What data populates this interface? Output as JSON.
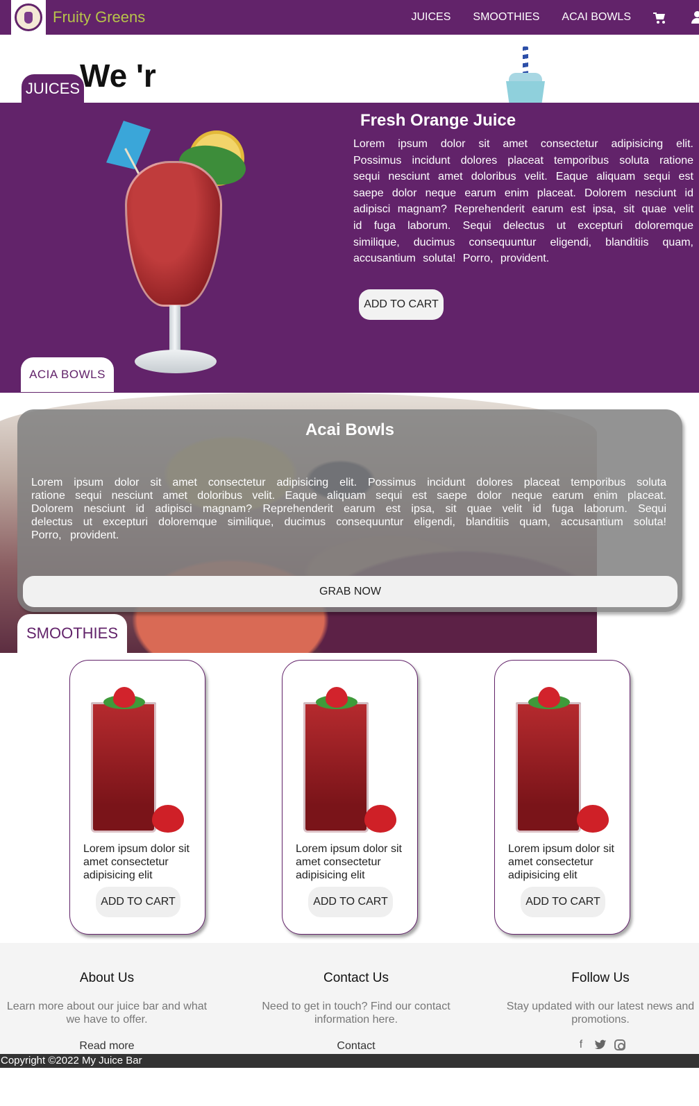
{
  "brand": {
    "name": "Fruity Greens"
  },
  "nav": {
    "links": [
      "JUICES",
      "SMOOTHIES",
      "ACAI BOWLS"
    ],
    "cart_icon": "cart-icon",
    "user_icon": "user-icon"
  },
  "hero": {
    "text": "We 'r"
  },
  "tabs": {
    "juices": "JUICES",
    "acai": "ACIA BOWLS",
    "smoothies": "SMOOTHIES"
  },
  "juice": {
    "title": "Fresh Orange Juice",
    "description": "Lorem ipsum dolor sit amet consectetur adipisicing elit. Possimus incidunt dolores placeat temporibus soluta ratione sequi nesciunt amet doloribus velit. Eaque aliquam sequi est saepe dolor neque earum enim placeat. Dolorem nesciunt id adipisci magnam? Reprehenderit earum est ipsa, sit quae velit id fuga laborum. Sequi delectus ut excepturi doloremque similique, ducimus consequuntur eligendi, blanditiis quam, accusantium soluta! Porro, provident.",
    "button": "ADD TO CART"
  },
  "acai": {
    "title": "Acai Bowls",
    "description": "Lorem ipsum dolor sit amet consectetur adipisicing elit. Possimus incidunt dolores placeat temporibus soluta ratione sequi nesciunt amet doloribus velit. Eaque aliquam sequi est saepe dolor neque earum enim placeat. Dolorem nesciunt id adipisci magnam? Reprehenderit earum est ipsa, sit quae velit id fuga laborum. Sequi delectus ut excepturi doloremque similique, ducimus consequuntur eligendi, blanditiis quam, accusantium soluta! Porro, provident.",
    "button": "GRAB NOW"
  },
  "smoothies": {
    "cards": [
      {
        "text": "Lorem ipsum dolor sit amet consectetur adipisicing elit",
        "button": "ADD TO CART"
      },
      {
        "text": "Lorem ipsum dolor sit amet consectetur adipisicing elit",
        "button": "ADD TO CART"
      },
      {
        "text": "Lorem ipsum dolor sit amet consectetur adipisicing elit",
        "button": "ADD TO CART"
      }
    ]
  },
  "footer": {
    "about": {
      "title": "About Us",
      "text": "Learn more about our juice bar and what we have to offer.",
      "link": "Read more"
    },
    "contact": {
      "title": "Contact Us",
      "text": "Need to get in touch? Find our contact information here.",
      "link": "Contact"
    },
    "follow": {
      "title": "Follow Us",
      "text": "Stay updated with our latest news and promotions.",
      "icons": [
        "facebook-icon",
        "twitter-icon",
        "instagram-icon"
      ]
    },
    "copyright": "Copyright ©2022 My Juice Bar"
  },
  "colors": {
    "primary": "#62236a",
    "brand_text": "#b7c44a",
    "button_bg": "#f2f2f2",
    "footer_bg": "#f4f4f4",
    "copyright_bg": "#333333"
  }
}
